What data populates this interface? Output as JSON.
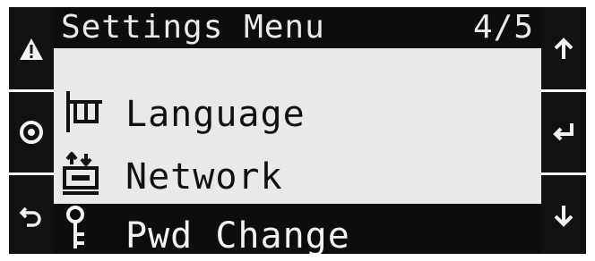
{
  "header": {
    "title": "Settings Menu",
    "page": "4/5"
  },
  "left_buttons": [
    {
      "icon": "warning-icon"
    },
    {
      "icon": "circle-icon"
    },
    {
      "icon": "back-arrow-icon"
    }
  ],
  "right_buttons": [
    {
      "icon": "arrow-up-icon"
    },
    {
      "icon": "enter-icon"
    },
    {
      "icon": "arrow-down-icon"
    }
  ],
  "menu": {
    "items": [
      {
        "label": "Language",
        "icon": "flag-icon"
      },
      {
        "label": "Network",
        "icon": "network-icon"
      },
      {
        "label": "Pwd Change",
        "icon": "key-icon",
        "selected": true
      }
    ]
  },
  "colors": {
    "frame": "#111111",
    "screen": "#e9e9e9",
    "highlight": "#0d0d0d",
    "text": "#111111"
  }
}
